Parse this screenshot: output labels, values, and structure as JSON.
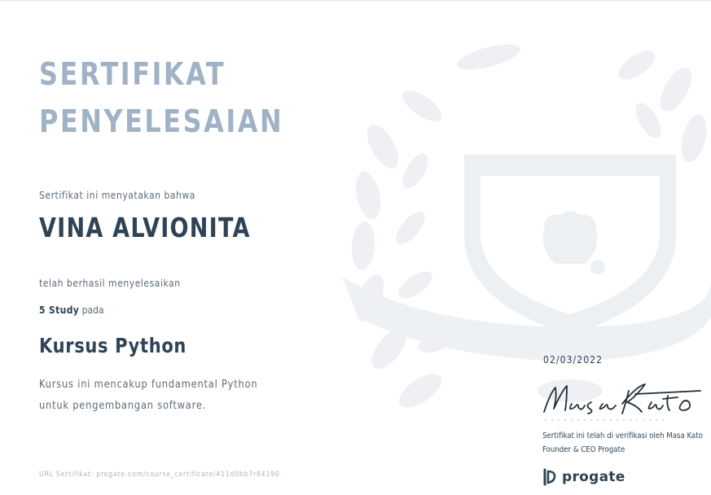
{
  "certificate": {
    "title_line1": "SERTIFIKAT",
    "title_line2": "PENYELESAIAN",
    "intro": "Sertifikat ini menyatakan bahwa",
    "recipient": "VINA ALVIONITA",
    "completed_text": "telah berhasil menyelesaikan",
    "study_count": "5 Study",
    "study_suffix": "pada",
    "course_name": "Kursus Python",
    "course_desc_line1": "Kursus ini mencakup fundamental Python",
    "course_desc_line2": "untuk pengembangan software.",
    "url_text": "URL Sertifikat: progate.com/course_certificate/411d0bb7r84190",
    "date": "02/03/2022",
    "signature": "Masa Kato",
    "verified_line1": "Sertifikat ini telah di verifikasi oleh Masa Kato",
    "verified_line2": "Founder & CEO Progate",
    "brand": "progate"
  },
  "colors": {
    "title": "#9fb2c6",
    "heading": "#2e4355",
    "body": "#5b6b7a",
    "muted": "#a9b5c1",
    "watermark": "#eef0f3"
  },
  "icons": {
    "watermark": "laurel-crest-watermark",
    "logo": "progate-logo-icon"
  }
}
